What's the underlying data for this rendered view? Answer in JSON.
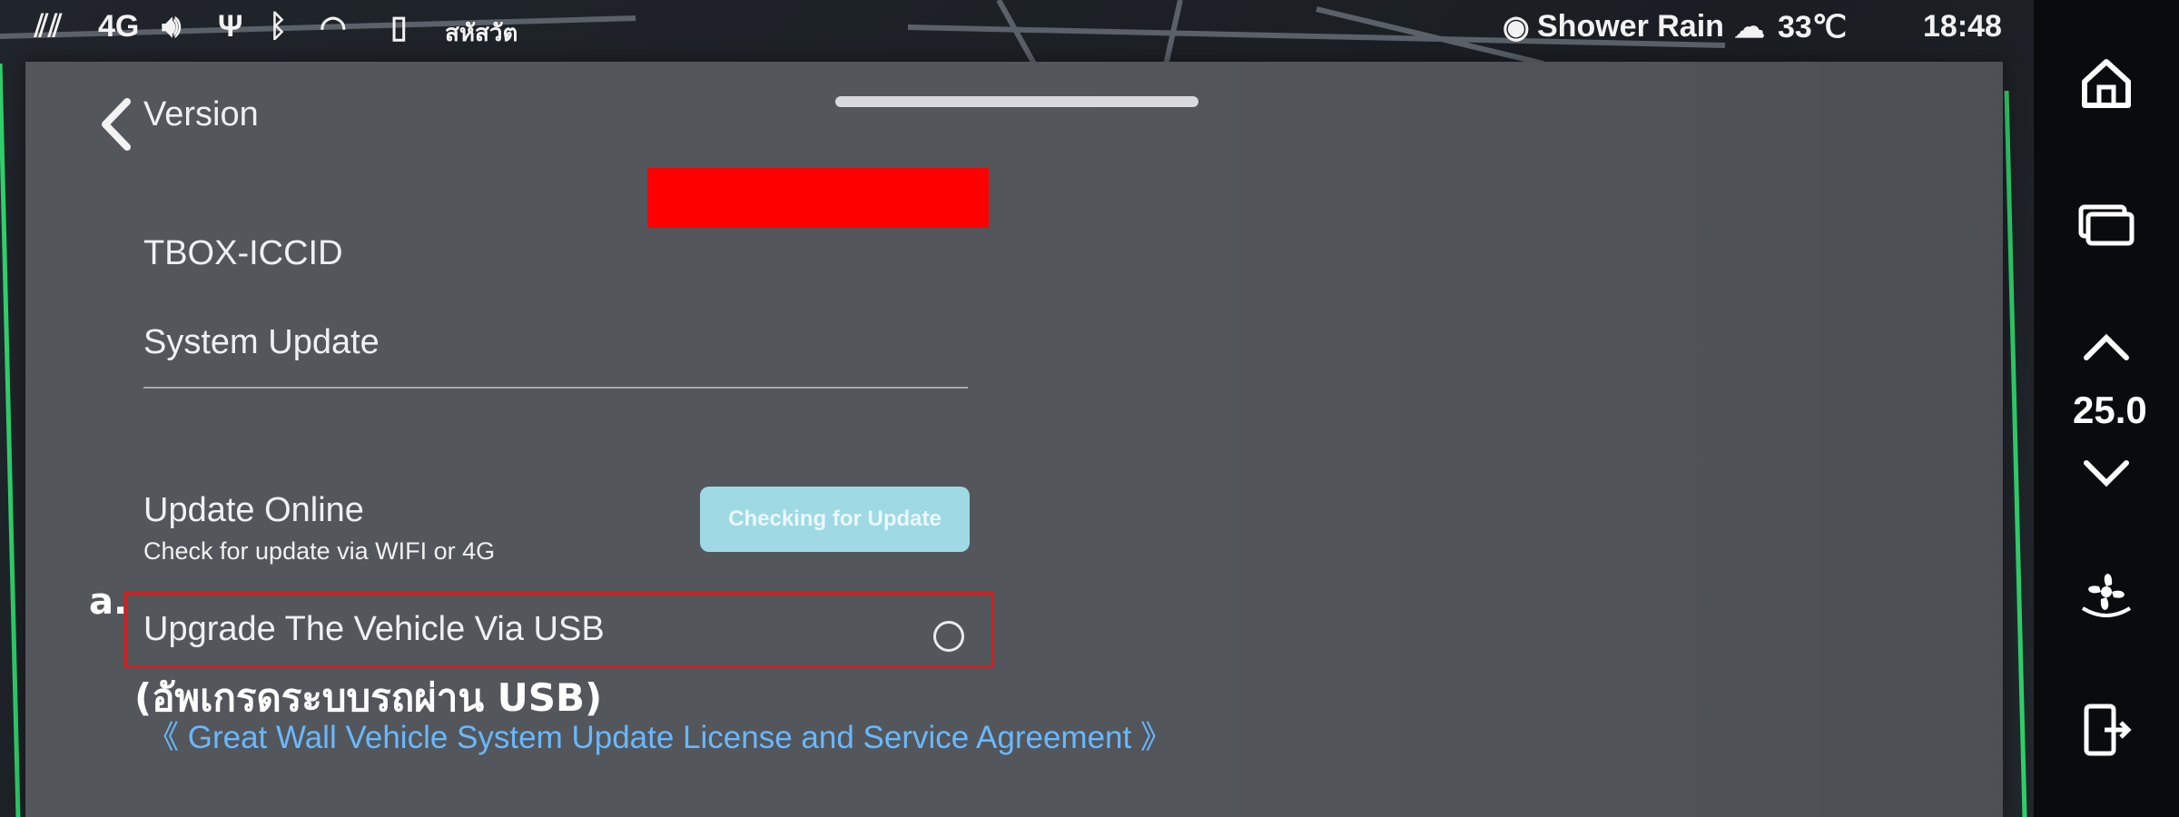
{
  "status_bar": {
    "network": "4G",
    "carrier_text": "สหัสวัต",
    "weather": "Shower Rain",
    "temperature": "33℃",
    "time": "18:48"
  },
  "page": {
    "title": "Version",
    "tbox_label": "TBOX-ICCID",
    "section_system_update": "System Update",
    "update_online": {
      "label": "Update Online",
      "description": "Check for update via WIFI or 4G",
      "button": "Checking for Update"
    },
    "annotation_letter": "a.",
    "usb_upgrade": {
      "label": "Upgrade The Vehicle Via USB",
      "thai_caption": "(อัพเกรดระบบรถผ่าน USB)"
    },
    "license_link": "《 Great Wall Vehicle System Update License and Service Agreement 》"
  },
  "right_bar": {
    "climate_temp": "25.0",
    "icons": [
      "home-icon",
      "multitask-icon",
      "temp-up-icon",
      "temp-down-icon",
      "fan-icon",
      "exit-icon"
    ]
  },
  "colors": {
    "panel": "#53565b",
    "link": "#69b8ff",
    "button": "#9fd9e4",
    "redaction": "#ff0000",
    "highlight": "#d81d1d"
  }
}
